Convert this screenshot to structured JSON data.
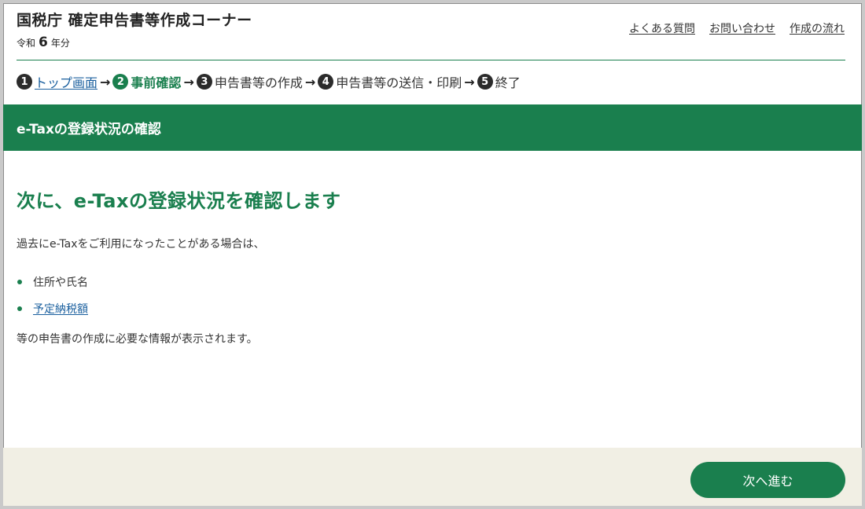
{
  "header": {
    "site_title": "国税庁 確定申告書等作成コーナー",
    "era_label": "令和",
    "year_number": "6",
    "year_suffix": "年分",
    "links": [
      "よくある質問",
      "お問い合わせ",
      "作成の流れ"
    ]
  },
  "steps": [
    {
      "number": "1",
      "label": "トップ画面"
    },
    {
      "number": "2",
      "label": "事前確認"
    },
    {
      "number": "3",
      "label": "申告書等の作成"
    },
    {
      "number": "4",
      "label": "申告書等の送信・印刷"
    },
    {
      "number": "5",
      "label": "終了"
    }
  ],
  "arrow": "→",
  "banner": {
    "title": "e-Taxの登録状況の確認"
  },
  "main": {
    "heading": "次に、e-Taxの登録状況を確認します",
    "intro": "過去にe-Taxをご利用になったことがある場合は、",
    "items": [
      {
        "label": "住所や氏名"
      },
      {
        "label": "予定納税額"
      }
    ],
    "outro": "等の申告書の作成に必要な情報が表示されます。"
  },
  "footer": {
    "next_label": "次へ進む"
  },
  "colors": {
    "brand": "#1a7f4e",
    "footer_bg": "#f1efe4",
    "link": "#1a5f9e"
  }
}
